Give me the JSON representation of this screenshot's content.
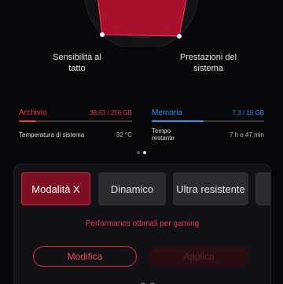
{
  "radar": {
    "accent": "#e6163a"
  },
  "metrics": {
    "left_label": "Sensibilità al\ntatto",
    "right_label": "Prestazioni del\nsistema"
  },
  "storage": {
    "label": "Archivio",
    "value": "38,63 / 256 GB",
    "color": "#e8364f",
    "fill": 0.15,
    "row_label": "Temperatura di sistema",
    "row_value": "32 °C"
  },
  "memory": {
    "label": "Memoria",
    "value": "7,3 / 16 GB",
    "color": "#3b8ff0",
    "fill": 0.46,
    "row_label": "Tempo\nrestante",
    "row_value": "7 h e 47 min"
  },
  "pager": {
    "count": 2,
    "active": 1
  },
  "modes": {
    "items": [
      {
        "label": "Modalità X"
      },
      {
        "label": "Dinamico"
      },
      {
        "label": "Ultra resistente"
      }
    ],
    "active": 0,
    "description": "Performance ottimali per gaming"
  },
  "actions": {
    "edit_label": "Modifica",
    "apply_label": "Applica"
  }
}
